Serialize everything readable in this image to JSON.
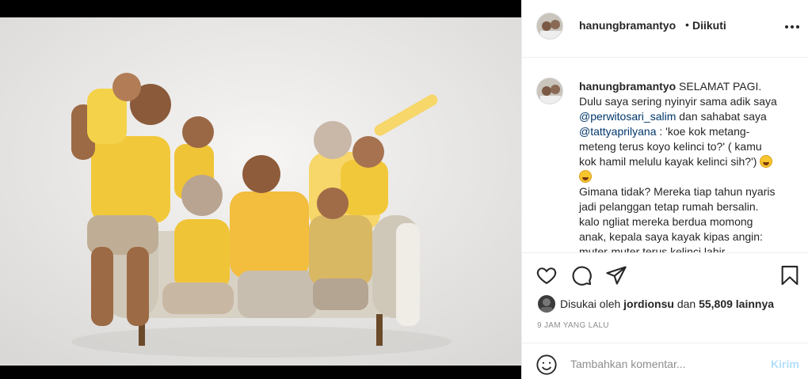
{
  "post": {
    "username": "hanungbramantyo",
    "dot": "•",
    "follow_state": "Diikuti"
  },
  "caption": {
    "username": "hanungbramantyo",
    "l1": " SELAMAT PAGI.",
    "l2": "Dulu saya sering nyinyir sama adik saya",
    "mention1": "@perwitosari_salim",
    "l3": " dan sahabat saya",
    "mention2": "@tattyaprilyana",
    "l4": " : 'koe kok metang-",
    "l5": "meteng terus koyo kelinci to?' ( kamu",
    "l6": "kok hamil melulu kayak kelinci sih?') ",
    "l7": "Gimana tidak? Mereka tiap tahun nyaris",
    "l8": "jadi pelanggan tetap rumah bersalin.",
    "l9": "kalo ngliat mereka berdua momong",
    "l10": "anak, kepala saya kayak kipas angin:",
    "l11": "muter-muter terus kelinci lahir"
  },
  "likes": {
    "prefix": "Disukai oleh ",
    "user": "jordionsu",
    "mid": " dan ",
    "count": "55,809 lainnya"
  },
  "time_ago": "9 JAM YANG LALU",
  "comment": {
    "placeholder": "Tambahkan komentar...",
    "post_label": "Kirim"
  },
  "icons": {
    "like": "heart-icon",
    "comment": "comment-icon",
    "share": "share-icon",
    "save": "bookmark-icon",
    "more": "more-options-icon",
    "emoji": "smiley-icon"
  },
  "colors": {
    "accent_link": "#00376b",
    "post_disabled": "#b2dffc",
    "muted": "#8e8e8e",
    "shirt_yellow": "#f2c83b"
  }
}
